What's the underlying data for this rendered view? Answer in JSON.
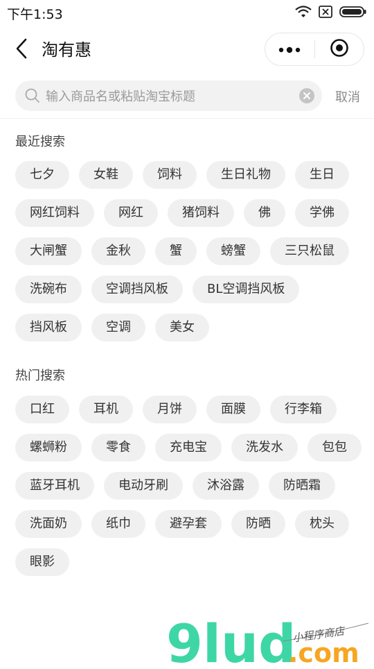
{
  "status_bar": {
    "time": "下午1:53",
    "icons": [
      "wifi-icon",
      "sim-none-icon",
      "battery-icon"
    ]
  },
  "nav": {
    "title": "淘有惠",
    "back_icon": "chevron-left-icon",
    "capsule_icons": [
      "more-dots-icon",
      "close-target-icon"
    ]
  },
  "search": {
    "placeholder": "输入商品名或粘贴淘宝标题",
    "value": "",
    "cancel_label": "取消"
  },
  "recent": {
    "title": "最近搜索",
    "tags": [
      "七夕",
      "女鞋",
      "饲料",
      "生日礼物",
      "生日",
      "网红饲料",
      "网红",
      "猪饲料",
      "佛",
      "学佛",
      "大闸蟹",
      "金秋",
      "蟹",
      "螃蟹",
      "三只松鼠",
      "洗碗布",
      "空调挡风板",
      "BL空调挡风板",
      "挡风板",
      "空调",
      "美女"
    ]
  },
  "hot": {
    "title": "热门搜索",
    "tags": [
      "口红",
      "耳机",
      "月饼",
      "面膜",
      "行李箱",
      "螺蛳粉",
      "零食",
      "充电宝",
      "洗发水",
      "包包",
      "蓝牙耳机",
      "电动牙刷",
      "沐浴露",
      "防晒霜",
      "洗面奶",
      "纸巾",
      "避孕套",
      "防晒",
      "枕头",
      "眼影"
    ]
  },
  "watermark": {
    "logo": "9lud",
    "domain": ".com",
    "tagline": "小程序商店"
  },
  "colors": {
    "tag_bg": "#f0f0f0",
    "search_bg": "#f2f2f2",
    "watermark_green": "#3fd6a6",
    "watermark_orange": "#f6a623"
  }
}
